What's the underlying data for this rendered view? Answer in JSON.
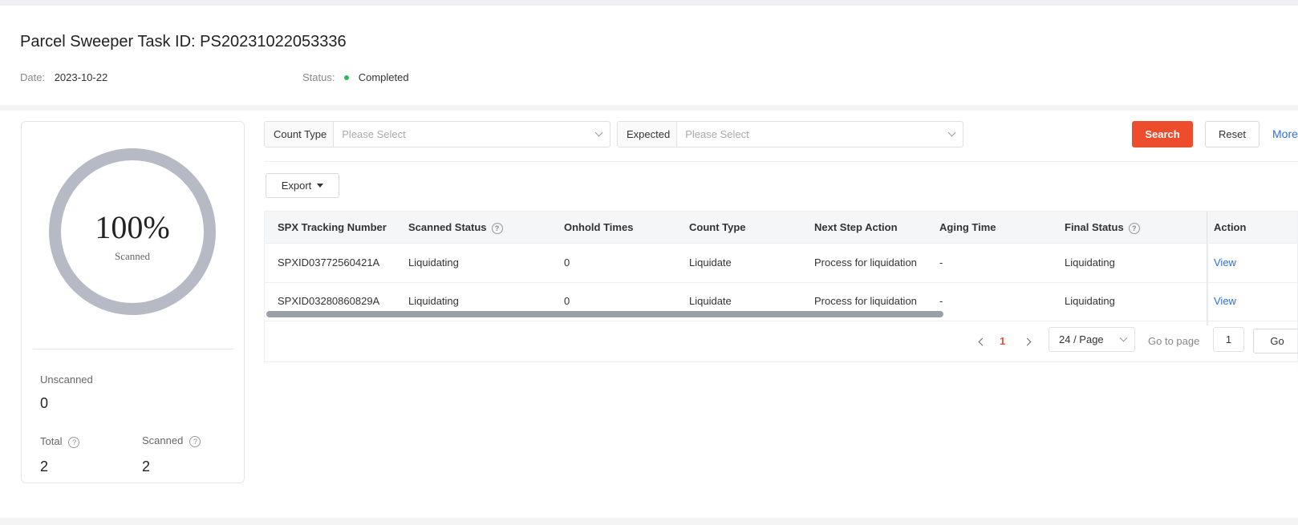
{
  "header": {
    "title": "Parcel Sweeper Task ID: PS20231022053336",
    "date_label": "Date:",
    "date_value": "2023-10-22",
    "status_label": "Status:",
    "status_value": "Completed",
    "status_color": "#2bbb5c"
  },
  "summary": {
    "percent": "100%",
    "percent_label": "Scanned",
    "progress": 1.0,
    "unscanned_label": "Unscanned",
    "unscanned_value": "0",
    "total_label": "Total",
    "total_value": "2",
    "scanned_label": "Scanned",
    "scanned_value": "2"
  },
  "filters": {
    "count_type_label": "Count Type",
    "count_type_placeholder": "Please Select",
    "expected_label": "Expected",
    "expected_placeholder": "Please Select",
    "search_label": "Search",
    "reset_label": "Reset",
    "more_label": "More",
    "accent_color": "#ee4d2d"
  },
  "toolbar": {
    "export_label": "Export"
  },
  "table": {
    "headers": [
      "SPX Tracking Number",
      "Scanned Status",
      "Onhold Times",
      "Count Type",
      "Next Step Action",
      "Aging Time",
      "Final Status",
      "Action"
    ],
    "rows": [
      [
        "SPXID03772560421A",
        "Liquidating",
        "0",
        "Liquidate",
        "Process for liquidation",
        "-",
        "Liquidating",
        "View"
      ],
      [
        "SPXID03280860829A",
        "Liquidating",
        "0",
        "Liquidate",
        "Process for liquidation",
        "-",
        "Liquidating",
        "View"
      ]
    ]
  },
  "pagination": {
    "current_page": "1",
    "page_size": "24 / Page",
    "goto_label": "Go to page",
    "goto_value": "1",
    "go_label": "Go"
  },
  "icons": [
    "help-icon",
    "chevron-down-icon",
    "caret-down-icon",
    "chevron-left-icon",
    "chevron-right-icon",
    "status-dot-icon"
  ]
}
